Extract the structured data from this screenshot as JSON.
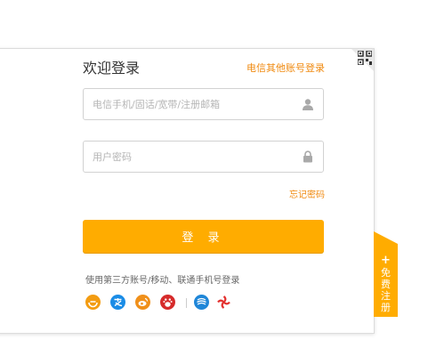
{
  "login": {
    "title": "欢迎登录",
    "alt_login_link": "电信其他账号登录",
    "account_placeholder": "电信手机/固话/宽带/注册邮箱",
    "password_placeholder": "用户密码",
    "forgot_password": "忘记密码",
    "login_button": "登 录",
    "third_party_label": "使用第三方账号/移动、联通手机号登录",
    "third_party_icons": [
      "tianyi-icon",
      "alipay-icon",
      "weibo-icon",
      "baidu-icon",
      "china-mobile-icon",
      "china-unicom-icon"
    ]
  },
  "register": {
    "plus": "+",
    "label": "免费注册"
  },
  "colors": {
    "accent": "#ffac00",
    "link": "#f08a10",
    "tianyi": "#f39c12",
    "alipay": "#1a8ce6",
    "weibo": "#f0901a",
    "baidu": "#d62b2b",
    "china_mobile": "#1f86d8",
    "china_unicom": "#e3312f"
  }
}
